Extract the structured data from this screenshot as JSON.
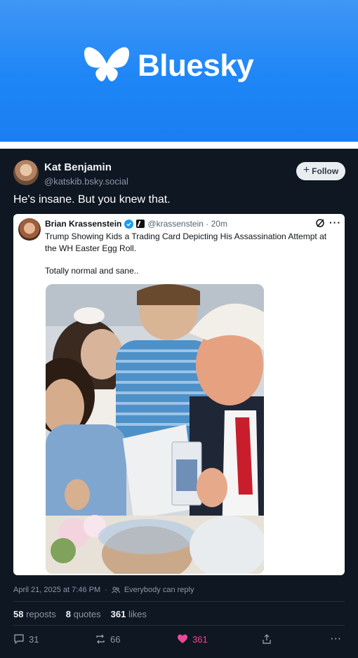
{
  "banner": {
    "brand_name": "Bluesky",
    "brand_color": "#1a7ef2",
    "logo_icon": "butterfly-icon"
  },
  "post": {
    "author": {
      "name": "Kat Benjamin",
      "handle": "@katskib.bsky.social"
    },
    "follow_label": "Follow",
    "text": "He's insane. But you knew that.",
    "quote": {
      "author_name": "Brian Krassenstein",
      "handle_time": "@krassenstein · 20m",
      "text_line1": "Trump Showing Kids a Trading Card Depicting His Assassination Attempt at the WH Easter Egg Roll.",
      "text_line2": "Totally normal and sane..",
      "verified_color": "#1d9bf0"
    },
    "timestamp": "April 21, 2025 at 7:46 PM",
    "reply_setting": "Everybody can reply",
    "stats": {
      "reposts_count": "58",
      "reposts_label": "reposts",
      "quotes_count": "8",
      "quotes_label": "quotes",
      "likes_count": "361",
      "likes_label": "likes"
    },
    "actions": {
      "replies": "31",
      "reposts": "66",
      "likes": "361",
      "like_color": "#ec4899"
    }
  }
}
